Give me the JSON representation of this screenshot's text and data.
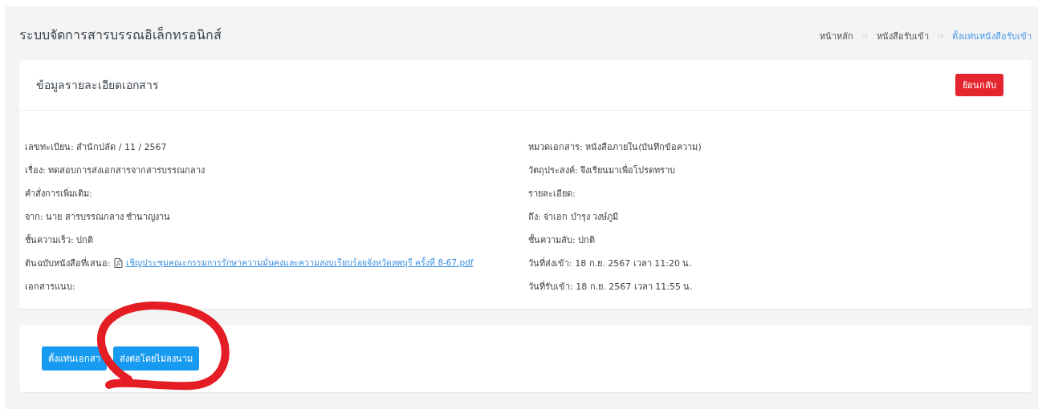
{
  "page_title": "ระบบจัดการสารบรรณอิเล็กทรอนิกส์",
  "breadcrumb": [
    {
      "label": "หน้าหลัก",
      "current": false
    },
    {
      "label": "หนังสือรับเข้า",
      "current": false
    },
    {
      "label": "ตั้งแท่นหนังสือรับเข้า",
      "current": true
    }
  ],
  "details_card": {
    "title": "ข้อมูลรายละเอียดเอกสาร",
    "back_button": "ย้อนกลับ",
    "left_fields": [
      {
        "kind": "text",
        "text": "เลขทะเบียน: สำนักปลัด / 11 / 2567"
      },
      {
        "kind": "text",
        "text": "เรื่อง: ทดสอบการส่งเอกสารจากสารบรรณกลาง"
      },
      {
        "kind": "text",
        "text": "คำสั่งการเพิ่มเติม:"
      },
      {
        "kind": "text",
        "text": "จาก: นาย สารบรรณกลาง ชำนาญงาน"
      },
      {
        "kind": "text",
        "text": "ชั้นความเร็ว: ปกติ"
      },
      {
        "kind": "file",
        "text": "ต้นฉบับหนังสือที่เสนอ:",
        "link": "เชิญประชุมคณะกรรมการรักษาความมั่นคงและความสงบเรียบร้อยจังหวัดลพบุรี ครั้งที่ 8-67.pdf"
      },
      {
        "kind": "text",
        "text": "เอกสารแนบ:"
      }
    ],
    "right_fields": [
      {
        "kind": "text",
        "text": "หมวดเอกสาร: หนังสือภายใน(บันทึกข้อความ)"
      },
      {
        "kind": "text",
        "text": "วัตถุประสงค์: จึงเรียนมาเพื่อโปรดทราบ"
      },
      {
        "kind": "text",
        "text": "รายละเอียด:"
      },
      {
        "kind": "text",
        "text": "ถึง: จ่าเอก บำรุง วงษ์ภูมี"
      },
      {
        "kind": "text",
        "text": "ชั้นความลับ: ปกติ"
      },
      {
        "kind": "text",
        "text": "วันที่ส่งเข้า: 18 ก.ย. 2567 เวลา 11:20 น."
      },
      {
        "kind": "text",
        "text": "วันที่รับเข้า: 18 ก.ย. 2567 เวลา 11:55 น."
      }
    ]
  },
  "actions": [
    "ตั้งแท่นเอกสา",
    "ส่งต่อโดยไม่ลงนาม"
  ]
}
